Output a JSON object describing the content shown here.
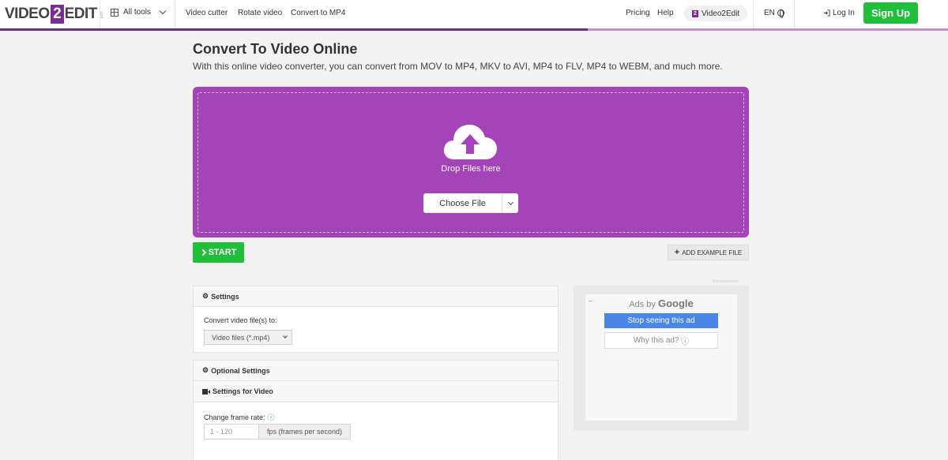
{
  "header": {
    "logo_left": "VIDEO",
    "logo_mid": "2",
    "logo_right": "EDIT",
    "logo_small": ".com",
    "all_tools": "All tools",
    "links": [
      "Video cutter",
      "Rotate video",
      "Convert to MP4"
    ],
    "pricing": "Pricing",
    "help": "Help",
    "brand_pill_icon": "2",
    "brand_pill": "Video2Edit",
    "lang": "EN",
    "login": "Log In",
    "signup": "Sign Up"
  },
  "main": {
    "title": "Convert To Video Online",
    "subtitle": "With this online video converter, you can convert from MOV to MP4, MKV to AVI, MP4 to FLV, MP4 to WEBM, and much more.",
    "drop_text": "Drop Files here",
    "choose_file": "Choose File",
    "start": "START",
    "add_example": "ADD EXAMPLE FILE"
  },
  "settings": {
    "header": "Settings",
    "convert_label": "Convert video file(s) to:",
    "format_value": "Video files (*.mp4)",
    "optional_header": "Optional Settings",
    "video_header": "Settings for Video",
    "frame_rate_label": "Change frame rate:",
    "frame_rate_placeholder": "1 - 120",
    "frame_rate_unit": "fps (frames per second)"
  },
  "ad": {
    "label": "Advertisement",
    "ads_by": "Ads by",
    "google": "Google",
    "stop": "Stop seeing this ad",
    "why": "Why this ad?"
  },
  "colors": {
    "accent_purple": "#a543b9",
    "brand_purple": "#7a2d8f",
    "green": "#1fbf3a"
  }
}
